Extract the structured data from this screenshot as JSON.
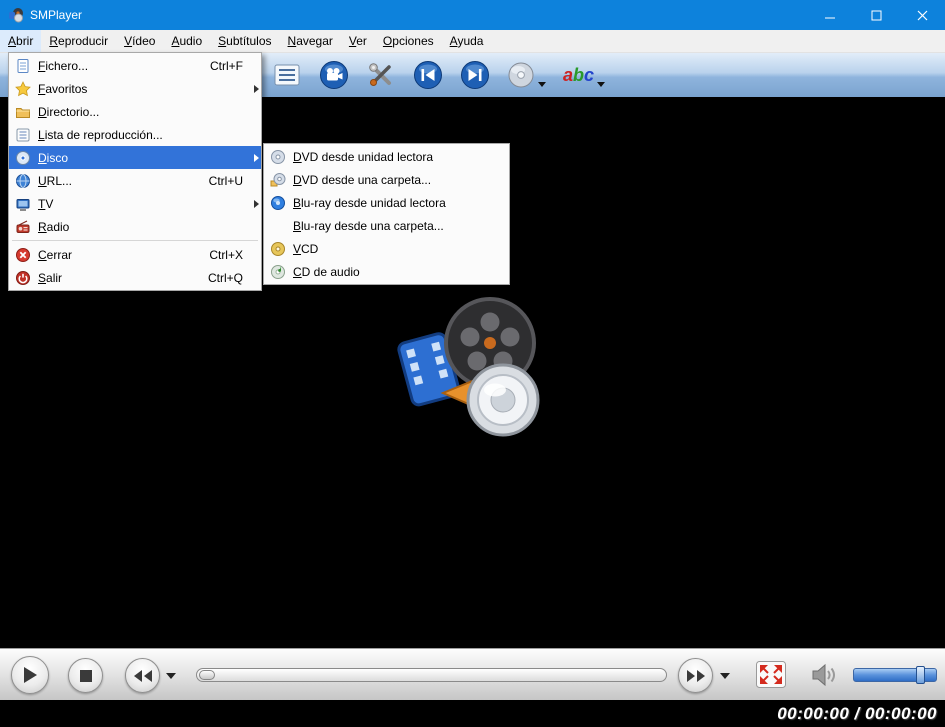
{
  "window": {
    "title": "SMPlayer"
  },
  "menubar": {
    "items": [
      {
        "label": "Abrir"
      },
      {
        "label": "Reproducir"
      },
      {
        "label": "Vídeo"
      },
      {
        "label": "Audio"
      },
      {
        "label": "Subtítulos"
      },
      {
        "label": "Navegar"
      },
      {
        "label": "Ver"
      },
      {
        "label": "Opciones"
      },
      {
        "label": "Ayuda"
      }
    ]
  },
  "toolbar": {
    "abc_letters": [
      "a",
      "b",
      "c"
    ]
  },
  "open_menu": {
    "items": [
      {
        "label": "Fichero...",
        "shortcut": "Ctrl+F",
        "icon": "file-icon"
      },
      {
        "label": "Favoritos",
        "icon": "star-icon",
        "has_submenu": true
      },
      {
        "label": "Directorio...",
        "icon": "folder-icon"
      },
      {
        "label": "Lista de reproducción...",
        "icon": "playlist-icon"
      },
      {
        "label": "Disco",
        "icon": "disc-icon",
        "has_submenu": true,
        "selected": true
      },
      {
        "label": "URL...",
        "shortcut": "Ctrl+U",
        "icon": "globe-icon"
      },
      {
        "label": "TV",
        "icon": "tv-icon",
        "has_submenu": true
      },
      {
        "label": "Radio",
        "icon": "radio-icon"
      },
      {
        "label": "Cerrar",
        "shortcut": "Ctrl+X",
        "icon": "close-red-icon"
      },
      {
        "label": "Salir",
        "shortcut": "Ctrl+Q",
        "icon": "power-icon"
      }
    ]
  },
  "disc_submenu": {
    "items": [
      {
        "label": "DVD desde unidad lectora",
        "icon": "dvd-disc-icon"
      },
      {
        "label": "DVD desde una carpeta...",
        "icon": "dvd-folder-icon"
      },
      {
        "label": "Blu-ray desde unidad lectora",
        "icon": "bluray-disc-icon"
      },
      {
        "label": "Blu-ray desde una carpeta..."
      },
      {
        "label": "VCD",
        "icon": "vcd-disc-icon"
      },
      {
        "label": "CD de audio",
        "icon": "audio-cd-icon"
      }
    ]
  },
  "statusbar": {
    "time": "00:00:00 / 00:00:00"
  },
  "colors": {
    "titlebar_blue": "#0d82dc",
    "menu_highlight_blue": "#3273d9",
    "toolbar_blue": "#8fb4dd",
    "fullscreen_arrow_red": "#d42b1e",
    "time_text": "#ffffff"
  }
}
